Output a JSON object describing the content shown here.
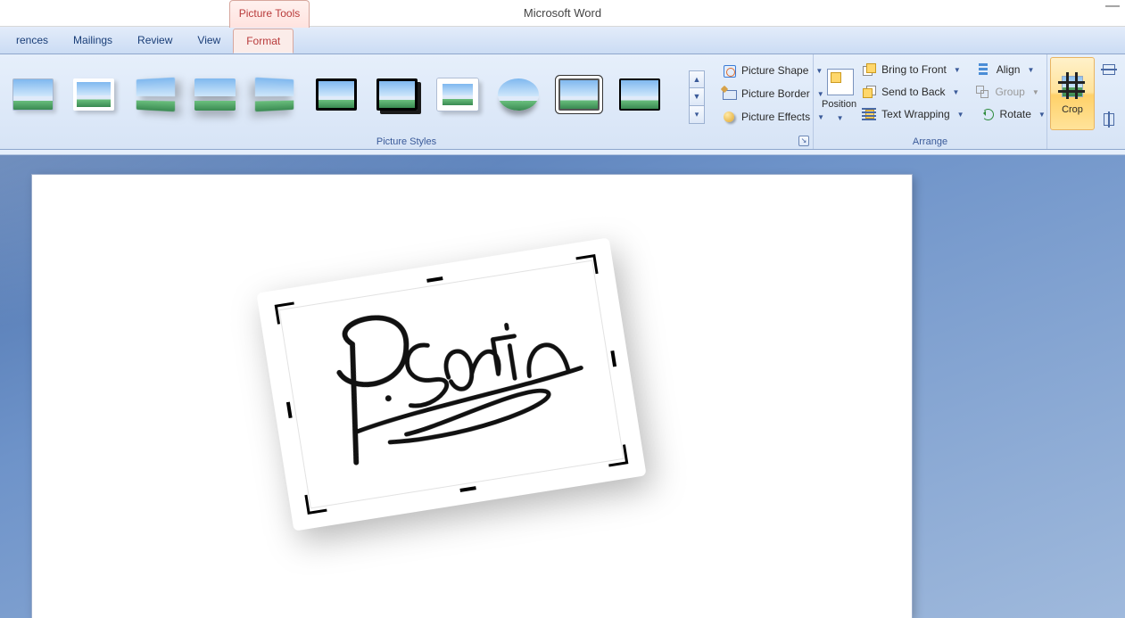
{
  "title": "Microsoft Word",
  "contextual_tab": "Picture Tools",
  "tabs": {
    "references": "rences",
    "mailings": "Mailings",
    "review": "Review",
    "view": "View",
    "format": "Format"
  },
  "groups": {
    "picture_styles": {
      "label": "Picture Styles",
      "shape": "Picture Shape",
      "border": "Picture Border",
      "effects": "Picture Effects"
    },
    "arrange": {
      "label": "Arrange",
      "position": "Position",
      "bring_front": "Bring to Front",
      "send_back": "Send to Back",
      "text_wrap": "Text Wrapping",
      "align": "Align",
      "group": "Group",
      "rotate": "Rotate"
    },
    "size": {
      "crop": "Crop"
    }
  },
  "picture": {
    "signature_text": "P. Smith"
  }
}
